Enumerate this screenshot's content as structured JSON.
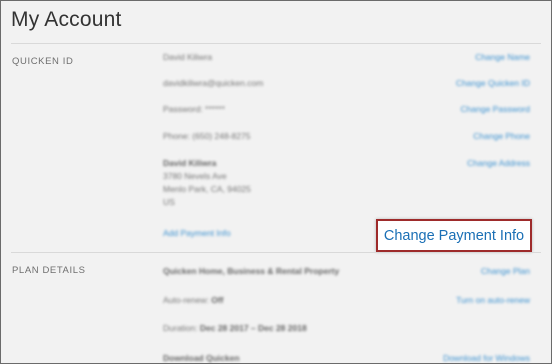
{
  "page": {
    "title": "My Account"
  },
  "quicken_id": {
    "label": "QUICKEN ID",
    "name": "David Kiliwra",
    "change_name": "Change Name",
    "email": "davidkiliwra@quicken.com",
    "change_id": "Change Quicken ID",
    "password": "Password: ******",
    "change_password": "Change Password",
    "phone": "Phone: (650) 248-8275",
    "change_phone": "Change Phone",
    "address_name": "David Kiliwra",
    "address_line1": "3780 Nevels Ave",
    "address_line2": "Menlo Park, CA, 94025",
    "address_country": "US",
    "change_address": "Change Address",
    "add_payment": "Add Payment Info",
    "change_payment": "Change Payment Info"
  },
  "plan_details": {
    "label": "PLAN DETAILS",
    "plan_name": "Quicken Home, Business & Rental Property",
    "change_plan": "Change Plan",
    "auto_renew_label": "Auto-renew:",
    "auto_renew_value": "Off",
    "auto_renew_link": "Turn on auto-renew",
    "duration_label": "Duration:",
    "duration_value": "Dec 28 2017 – Dec 28 2018",
    "download_label": "Download Quicken",
    "download_link": "Download for Windows"
  }
}
